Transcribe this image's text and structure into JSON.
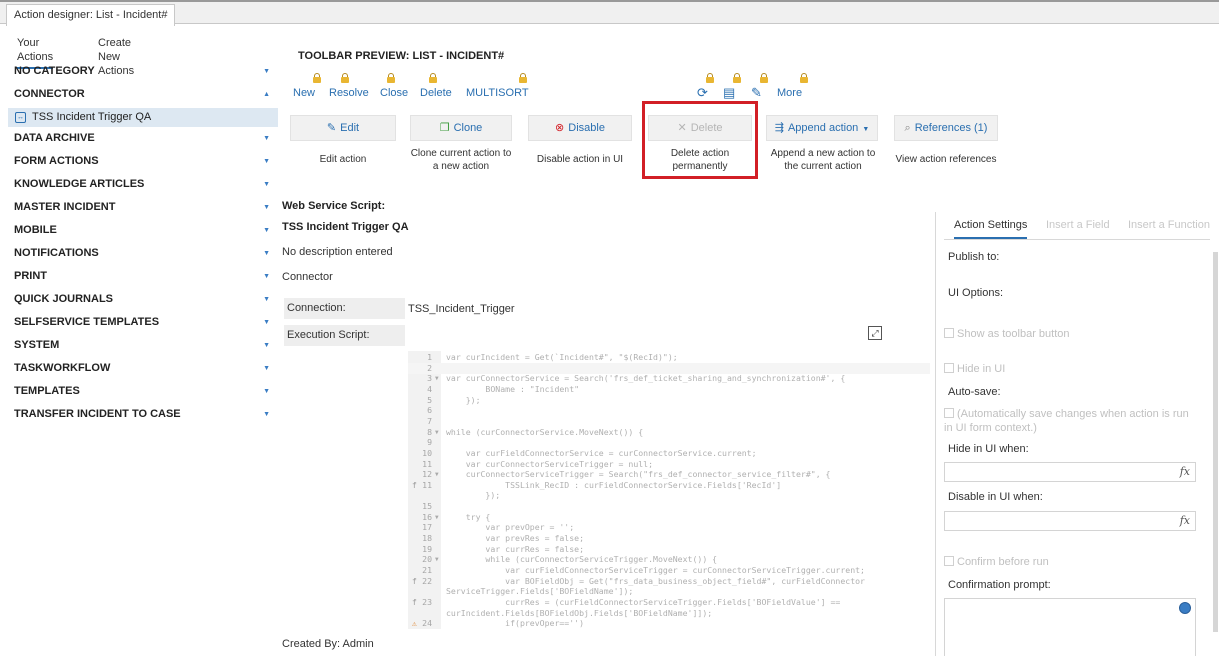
{
  "window": {
    "doc_tab": "Action designer: List - Incident#"
  },
  "left_tabs": [
    {
      "label": "Your Actions",
      "active": true
    },
    {
      "label": "Create New Actions",
      "active": false
    }
  ],
  "categories": [
    {
      "label": "NO CATEGORY",
      "expanded": false
    },
    {
      "label": "CONNECTOR",
      "expanded": true,
      "sub": "TSS Incident Trigger QA"
    },
    {
      "label": "DATA ARCHIVE",
      "expanded": false
    },
    {
      "label": "FORM ACTIONS",
      "expanded": false
    },
    {
      "label": "KNOWLEDGE ARTICLES",
      "expanded": false
    },
    {
      "label": "MASTER INCIDENT",
      "expanded": false
    },
    {
      "label": "MOBILE",
      "expanded": false
    },
    {
      "label": "NOTIFICATIONS",
      "expanded": false
    },
    {
      "label": "PRINT",
      "expanded": false
    },
    {
      "label": "QUICK JOURNALS",
      "expanded": false
    },
    {
      "label": "SELFSERVICE TEMPLATES",
      "expanded": false
    },
    {
      "label": "SYSTEM",
      "expanded": false
    },
    {
      "label": "TASKWORKFLOW",
      "expanded": false
    },
    {
      "label": "TEMPLATES",
      "expanded": false
    },
    {
      "label": "TRANSFER INCIDENT TO CASE",
      "expanded": false
    }
  ],
  "preview": {
    "title": "TOOLBAR PREVIEW: LIST - INCIDENT#",
    "links": [
      "New",
      "Resolve",
      "Close",
      "Delete",
      "MULTISORT"
    ],
    "more": "More",
    "icons": [
      "refresh-icon",
      "print-icon",
      "pin-icon"
    ]
  },
  "actions": [
    {
      "label": "Edit",
      "icon": "pencil-icon",
      "desc": [
        "Edit action"
      ],
      "disabled": false
    },
    {
      "label": "Clone",
      "icon": "clone-icon",
      "desc": [
        "Clone current action to",
        "a new action"
      ],
      "disabled": false
    },
    {
      "label": "Disable",
      "icon": "disable-icon",
      "desc": [
        "Disable action in UI"
      ],
      "disabled": false
    },
    {
      "label": "Delete",
      "icon": "x-icon",
      "desc": [
        "Delete action",
        "permanently"
      ],
      "disabled": true
    },
    {
      "label": "Append action",
      "icon": "append-icon",
      "desc": [
        "Append a new action to",
        "the current action"
      ],
      "disabled": false
    },
    {
      "label": "References (1)",
      "icon": "search-icon",
      "desc": [
        "View action references"
      ],
      "disabled": false
    }
  ],
  "ws": {
    "title": "Web Service Script:",
    "name": "TSS Incident Trigger QA",
    "description": "No description entered",
    "type": "Connector",
    "connection_label": "Connection:",
    "connection_value": "TSS_Incident_Trigger",
    "script_label": "Execution Script:"
  },
  "code_lines": [
    {
      "n": "1",
      "t": "var curIncident = Get(`Incident#\", \"$(RecId)\");",
      "fold": false
    },
    {
      "n": "2",
      "t": "",
      "fold": false
    },
    {
      "n": "3",
      "t": "var curConnectorService = Search('frs_def_ticket_sharing_and_synchronization#', {",
      "fold": true
    },
    {
      "n": "4",
      "t": "        BOName : \"Incident\"",
      "fold": false
    },
    {
      "n": "5",
      "t": "    });",
      "fold": false
    },
    {
      "n": "6",
      "t": "",
      "fold": false
    },
    {
      "n": "7",
      "t": "",
      "fold": false
    },
    {
      "n": "8",
      "t": "while (curConnectorService.MoveNext()) {",
      "fold": true
    },
    {
      "n": "9",
      "t": "",
      "fold": false
    },
    {
      "n": "10",
      "t": "    var curFieldConnectorService = curConnectorService.current;",
      "fold": false
    },
    {
      "n": "11",
      "t": "    var curConnectorServiceTrigger = null;",
      "fold": false
    },
    {
      "n": "12",
      "t": "    curConnectorServiceTrigger = Search(\"frs_def_connector_service_filter#\", {",
      "fold": true
    },
    {
      "n": "11",
      "t": "            TSSLink_RecID : curFieldConnectorService.Fields['RecId']",
      "fold": false
    },
    {
      "n": "",
      "t": "        });",
      "fold": false
    },
    {
      "n": "15",
      "t": "",
      "fold": false
    },
    {
      "n": "16",
      "t": "    try {",
      "fold": true
    },
    {
      "n": "17",
      "t": "        var prevOper = '';",
      "fold": false
    },
    {
      "n": "18",
      "t": "        var prevRes = false;",
      "fold": false
    },
    {
      "n": "19",
      "t": "        var currRes = false;",
      "fold": false
    },
    {
      "n": "20",
      "t": "        while (curConnectorServiceTrigger.MoveNext()) {",
      "fold": true
    },
    {
      "n": "21",
      "t": "            var curFieldConnectorServiceTrigger = curConnectorServiceTrigger.current;",
      "fold": false
    },
    {
      "n": "22",
      "t": "            var BOFieldObj = Get(\"frs_data_business_object_field#\", curFieldConnector",
      "fold": false
    },
    {
      "n": "",
      "t": "ServiceTrigger.Fields['BOFieldName']);",
      "fold": false
    },
    {
      "n": "23",
      "t": "            currRes = (curFieldConnectorServiceTrigger.Fields['BOFieldValue'] ==",
      "fold": false
    },
    {
      "n": "",
      "t": "curIncident.Fields[BOFieldObj.Fields['BOFieldName']]);",
      "fold": false
    },
    {
      "n": "24",
      "t": "            if(prevOper=='')",
      "fold": false
    }
  ],
  "created_by": "Created By: Admin",
  "right_panel": {
    "tabs": [
      {
        "label": "Action Settings",
        "active": true
      },
      {
        "label": "Insert a Field",
        "active": false
      },
      {
        "label": "Insert a Function",
        "active": false
      }
    ],
    "publish_to": "Publish to:",
    "ui_options": "UI Options:",
    "show_toolbar": "Show as toolbar button",
    "hide_in_ui": "Hide in UI",
    "auto_save": "Auto-save:",
    "auto_save_desc": "(Automatically save changes when action is run in UI form context.)",
    "hide_when": "Hide in UI when:",
    "disable_when": "Disable in UI when:",
    "fx": "fx",
    "confirm": "Confirm before run",
    "confirm_prompt": "Confirmation prompt:"
  },
  "colors": {
    "accent": "#2a6fb0",
    "highlight": "#d21f26",
    "lock": "#e9b632"
  }
}
